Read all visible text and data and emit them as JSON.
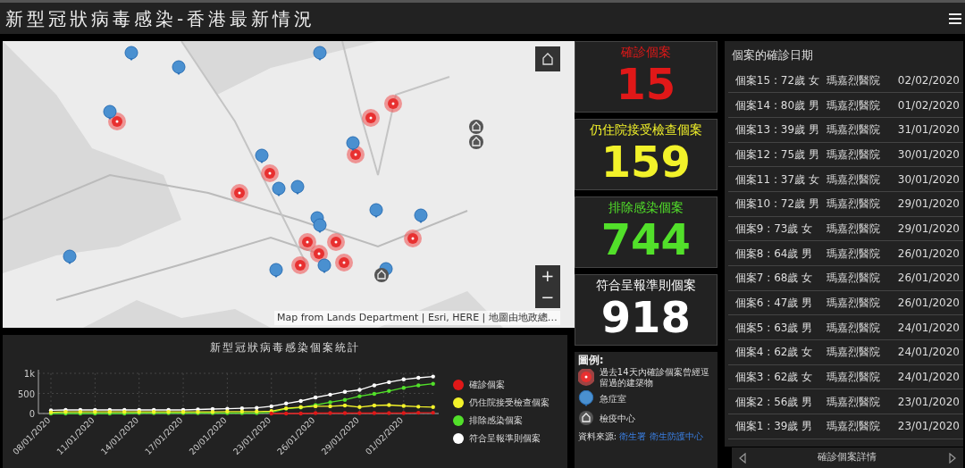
{
  "window": {
    "title": "新型冠狀病毒感染-香港最新情況"
  },
  "map": {
    "attribution": "Map from Lands Department | Esri, HERE | 地圖由地政總…",
    "zoom_in": "+",
    "zoom_out": "−"
  },
  "stats": [
    {
      "label": "確診個案",
      "value": "15",
      "color": "#e01818"
    },
    {
      "label": "仍住院接受檢查個案",
      "value": "159",
      "color": "#f2f22a"
    },
    {
      "label": "排除感染個案",
      "value": "744",
      "color": "#52e02a"
    },
    {
      "label": "符合呈報準則個案",
      "value": "918",
      "color": "#ffffff"
    }
  ],
  "legend": {
    "title": "圖例:",
    "items": [
      {
        "kind": "heat",
        "label": "過去14天內確診個案曾經逗留過的建築物"
      },
      {
        "kind": "ae",
        "label": "急症室"
      },
      {
        "kind": "quarantine",
        "label": "檢疫中心"
      }
    ],
    "source_label": "資料來源:",
    "source_links": [
      "衛生署",
      "衛生防護中心"
    ]
  },
  "cases": {
    "title": "個案的確診日期",
    "rows": [
      {
        "case": "個案15 : 72歲 女",
        "hospital": "瑪嘉烈醫院",
        "date": "02/02/2020"
      },
      {
        "case": "個案14 : 80歲 男",
        "hospital": "瑪嘉烈醫院",
        "date": "01/02/2020"
      },
      {
        "case": "個案13 : 39歲 男",
        "hospital": "瑪嘉烈醫院",
        "date": "31/01/2020"
      },
      {
        "case": "個案12 : 75歲 男",
        "hospital": "瑪嘉烈醫院",
        "date": "30/01/2020"
      },
      {
        "case": "個案11 : 37歲 女",
        "hospital": "瑪嘉烈醫院",
        "date": "30/01/2020"
      },
      {
        "case": "個案10 : 72歲 男",
        "hospital": "瑪嘉烈醫院",
        "date": "29/01/2020"
      },
      {
        "case": "個案9 : 73歲 女",
        "hospital": "瑪嘉烈醫院",
        "date": "29/01/2020"
      },
      {
        "case": "個案8 : 64歲 男",
        "hospital": "瑪嘉烈醫院",
        "date": "26/01/2020"
      },
      {
        "case": "個案7 : 68歲 女",
        "hospital": "瑪嘉烈醫院",
        "date": "26/01/2020"
      },
      {
        "case": "個案6 : 47歲 男",
        "hospital": "瑪嘉烈醫院",
        "date": "26/01/2020"
      },
      {
        "case": "個案5 : 63歲 男",
        "hospital": "瑪嘉烈醫院",
        "date": "24/01/2020"
      },
      {
        "case": "個案4 : 62歲 女",
        "hospital": "瑪嘉烈醫院",
        "date": "24/01/2020"
      },
      {
        "case": "個案3 : 62歲 女",
        "hospital": "瑪嘉烈醫院",
        "date": "24/01/2020"
      },
      {
        "case": "個案2 : 56歲 男",
        "hospital": "瑪嘉烈醫院",
        "date": "23/01/2020"
      },
      {
        "case": "個案1 : 39歲 男",
        "hospital": "瑪嘉烈醫院",
        "date": "23/01/2020"
      }
    ],
    "footer": "確診個案詳情"
  },
  "chart_panel": {
    "chart_data": {
      "type": "line",
      "title": "新型冠狀病毒感染個案統計",
      "categories": [
        "08/01/2020",
        null,
        null,
        "11/01/2020",
        null,
        null,
        "14/01/2020",
        null,
        null,
        "17/01/2020",
        null,
        null,
        "20/01/2020",
        null,
        null,
        "23/01/2020",
        null,
        null,
        "26/01/2020",
        null,
        null,
        "29/01/2020",
        null,
        null,
        "01/02/2020",
        null,
        null
      ],
      "yticks": [
        0,
        500,
        {
          "value": 1000,
          "label": "1k"
        }
      ],
      "ylim": [
        0,
        1000
      ],
      "grid": true,
      "series": [
        {
          "name": "確診個案",
          "color": "#e01818",
          "values": [
            null,
            null,
            null,
            null,
            null,
            null,
            null,
            null,
            null,
            null,
            null,
            null,
            null,
            null,
            null,
            0,
            0,
            0,
            10,
            10,
            10,
            10,
            10,
            10,
            10,
            20,
            20
          ]
        },
        {
          "name": "仍住院接受檢查個案",
          "color": "#f2f22a",
          "values": [
            30,
            40,
            40,
            40,
            40,
            40,
            40,
            40,
            40,
            40,
            40,
            40,
            50,
            50,
            50,
            60,
            130,
            160,
            180,
            180,
            200,
            160,
            200,
            210,
            190,
            170,
            160
          ]
        },
        {
          "name": "排除感染個案",
          "color": "#52e02a",
          "values": [
            0,
            0,
            0,
            0,
            0,
            0,
            10,
            10,
            10,
            10,
            10,
            10,
            10,
            10,
            10,
            30,
            120,
            150,
            210,
            280,
            340,
            430,
            490,
            560,
            640,
            700,
            740
          ]
        },
        {
          "name": "符合呈報準則個案",
          "color": "#ffffff",
          "values": [
            80,
            90,
            90,
            90,
            90,
            90,
            90,
            90,
            90,
            90,
            100,
            110,
            120,
            130,
            140,
            180,
            250,
            310,
            400,
            470,
            540,
            590,
            700,
            780,
            850,
            890,
            920
          ]
        }
      ]
    }
  }
}
